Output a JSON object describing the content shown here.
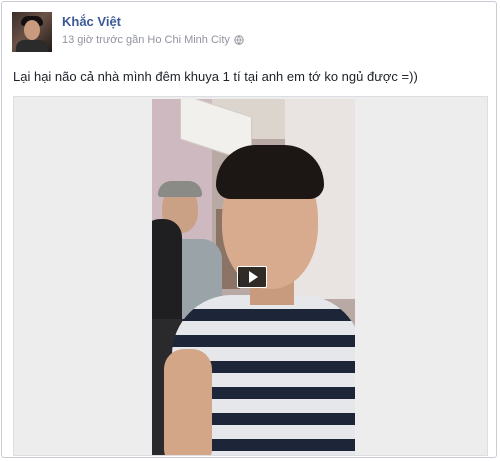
{
  "post": {
    "author": "Khắc Việt",
    "meta": "13 giờ trước gần Ho Chi Minh City",
    "text": "Lại hại não cả nhà mình đêm khuya 1 tí tại anh em tớ ko ngủ được =))"
  },
  "icons": {
    "privacy": "globe-icon",
    "play": "play-icon"
  },
  "colors": {
    "author_link": "#3b5998",
    "meta_text": "#90949c",
    "body_text": "#1d2129",
    "card_border": "#c9ccd2"
  }
}
